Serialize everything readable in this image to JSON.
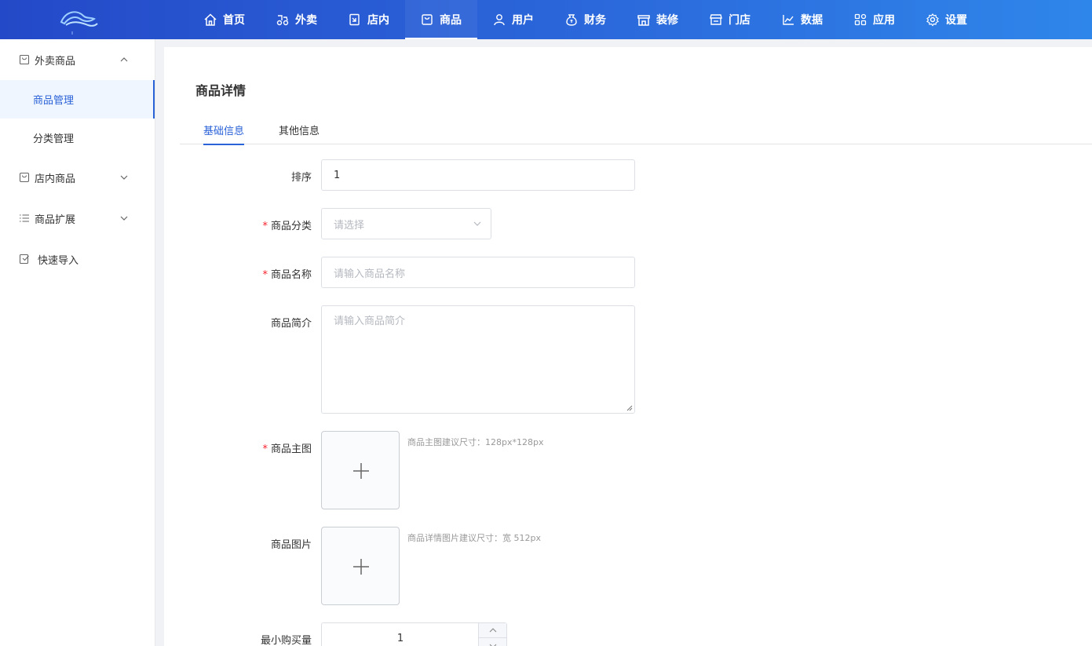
{
  "nav": {
    "items": [
      {
        "label": "首页",
        "icon": "home-icon"
      },
      {
        "label": "外卖",
        "icon": "delivery-icon"
      },
      {
        "label": "店内",
        "icon": "dine-in-icon"
      },
      {
        "label": "商品",
        "icon": "product-icon"
      },
      {
        "label": "用户",
        "icon": "user-icon"
      },
      {
        "label": "财务",
        "icon": "money-bag-icon"
      },
      {
        "label": "装修",
        "icon": "storefront-icon"
      },
      {
        "label": "门店",
        "icon": "shop-icon"
      },
      {
        "label": "数据",
        "icon": "chart-icon"
      },
      {
        "label": "应用",
        "icon": "apps-icon"
      },
      {
        "label": "设置",
        "icon": "gear-icon"
      }
    ],
    "active": "商品"
  },
  "sidebar": {
    "groups": [
      {
        "label": "外卖商品",
        "icon": "bag-icon",
        "expanded": true,
        "items": [
          {
            "label": "商品管理",
            "active": true
          },
          {
            "label": "分类管理",
            "active": false
          }
        ]
      },
      {
        "label": "店内商品",
        "icon": "bag-icon",
        "expanded": false
      },
      {
        "label": "商品扩展",
        "icon": "list-icon",
        "expanded": false
      },
      {
        "label": "快速导入",
        "icon": "import-icon"
      }
    ]
  },
  "page": {
    "title": "商品详情",
    "tabs": [
      {
        "label": "基础信息",
        "active": true
      },
      {
        "label": "其他信息",
        "active": false
      }
    ]
  },
  "form": {
    "sort": {
      "label": "排序",
      "value": "1"
    },
    "category": {
      "label": "商品分类",
      "required": true,
      "placeholder": "请选择"
    },
    "name": {
      "label": "商品名称",
      "required": true,
      "placeholder": "请输入商品名称"
    },
    "intro": {
      "label": "商品简介",
      "placeholder": "请输入商品简介"
    },
    "main_image": {
      "label": "商品主图",
      "required": true,
      "hint": "商品主图建议尺寸：128px*128px"
    },
    "images": {
      "label": "商品图片",
      "hint": "商品详情图片建议尺寸：宽 512px"
    },
    "min_qty": {
      "label": "最小购买量",
      "value": "1"
    }
  },
  "colors": {
    "primary": "#2a62d8",
    "required": "#f5222d"
  }
}
